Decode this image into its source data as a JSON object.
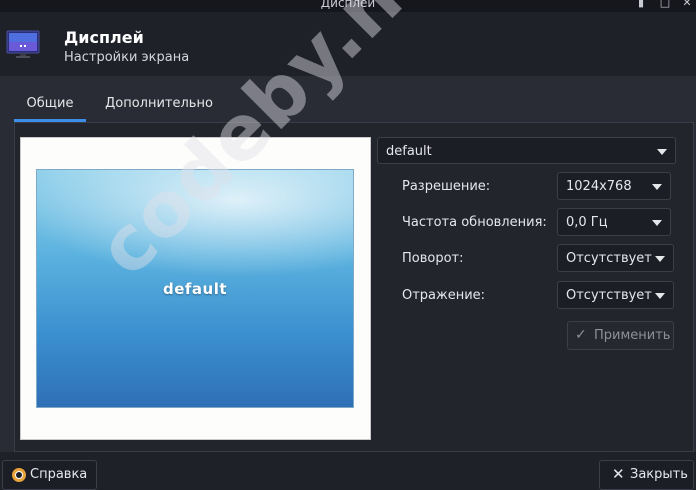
{
  "window": {
    "title": "Дисплей"
  },
  "header": {
    "title": "Дисплей",
    "subtitle": "Настройки экрана",
    "icon": "monitor-icon"
  },
  "tabs": [
    {
      "label": "Общие",
      "active": true
    },
    {
      "label": "Дополнительно",
      "active": false
    }
  ],
  "preview": {
    "label": "default"
  },
  "display_select": {
    "value": "default"
  },
  "fields": {
    "resolution": {
      "label": "Разрешение:",
      "value": "1024x768"
    },
    "refresh": {
      "label": "Частота обновления:",
      "value": "0,0 Гц"
    },
    "rotation": {
      "label": "Поворот:",
      "value": "Отсутствует"
    },
    "reflection": {
      "label": "Отражение:",
      "value": "Отсутствует"
    }
  },
  "buttons": {
    "apply": "Применить",
    "help": "Справка",
    "close": "Закрыть"
  },
  "watermark": "codeby.net",
  "colors": {
    "accent": "#3d8ee8",
    "background": "#1f2129",
    "panel": "#2a2c35"
  }
}
